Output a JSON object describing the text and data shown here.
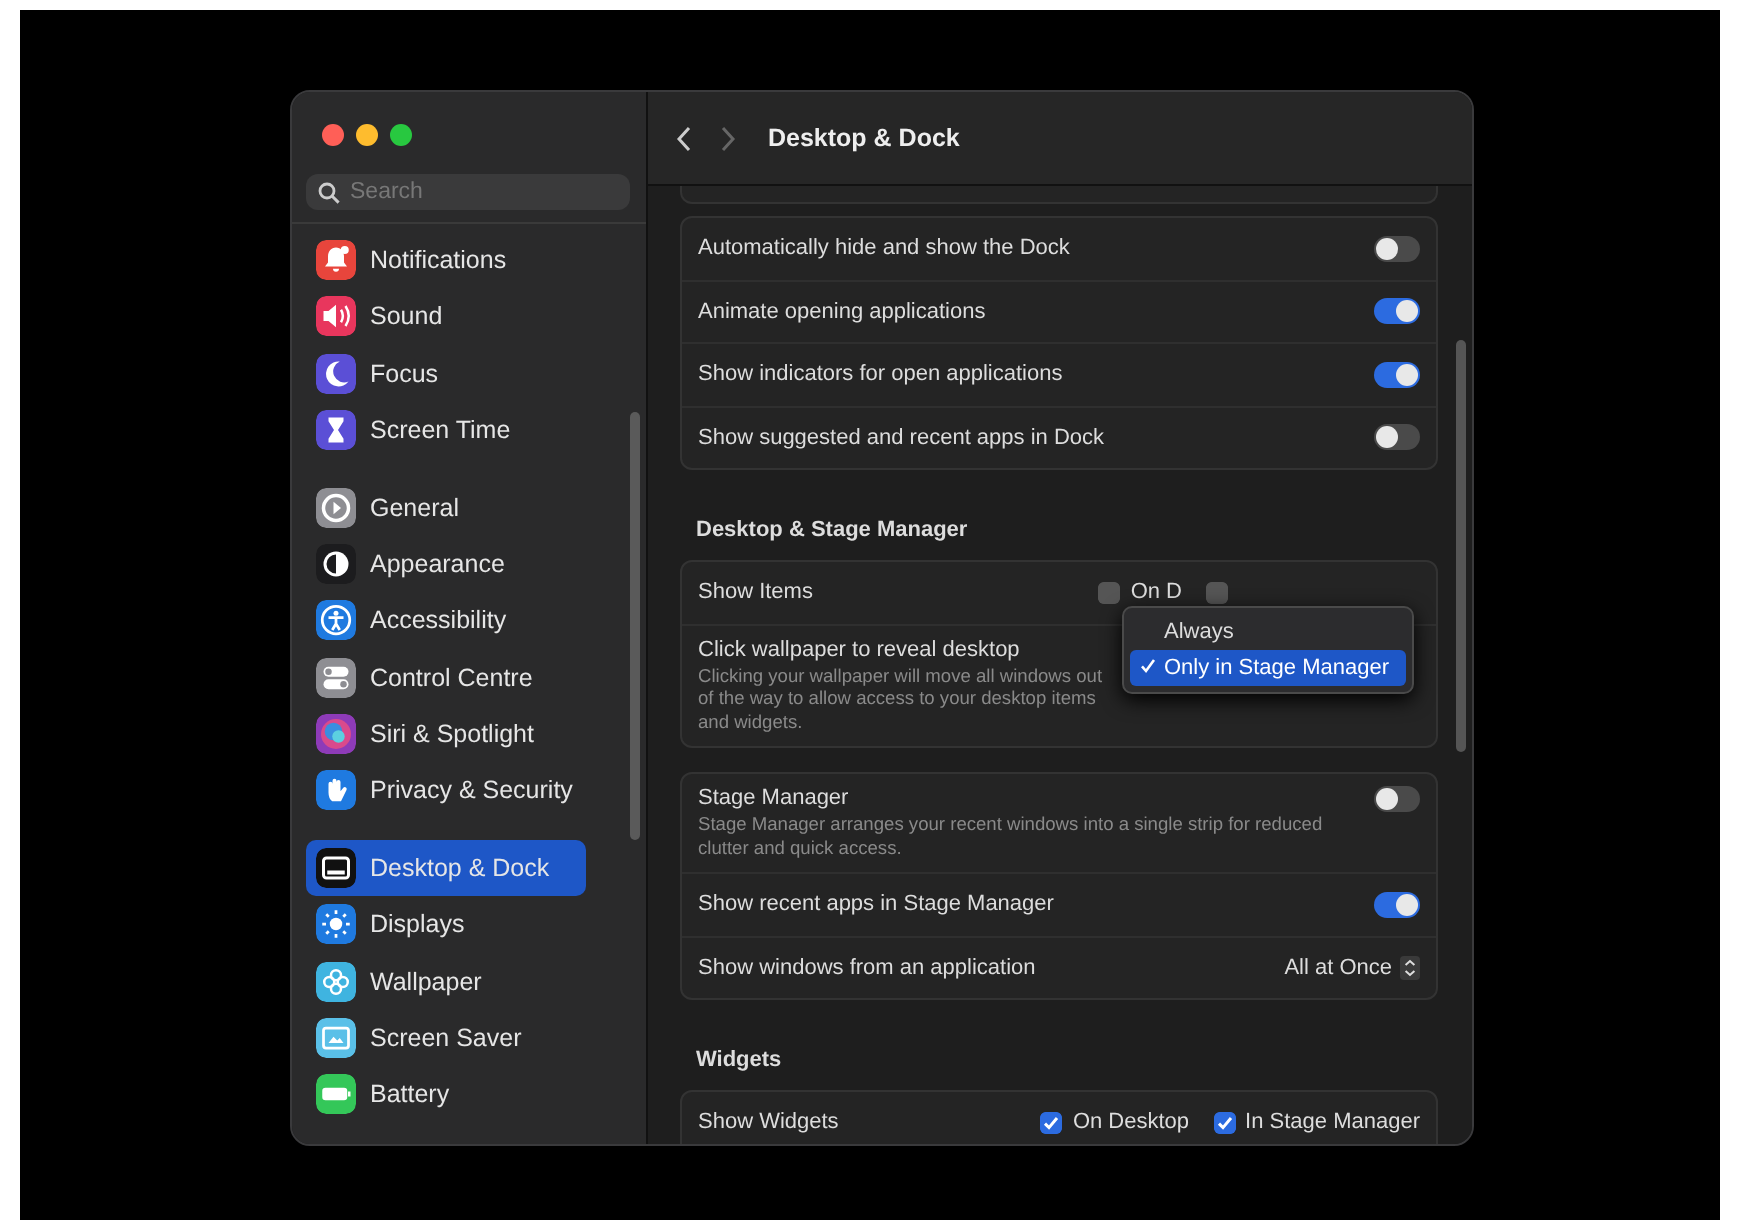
{
  "sidebar": {
    "search": {
      "placeholder": "Search"
    },
    "groups": [
      [
        {
          "label": "Notifications",
          "color": "#e8453c",
          "selected": false
        },
        {
          "label": "Sound",
          "color": "#e8365d",
          "selected": false
        },
        {
          "label": "Focus",
          "color": "#5b4fd6",
          "selected": false
        },
        {
          "label": "Screen Time",
          "color": "#5b4fd6",
          "selected": false
        }
      ],
      [
        {
          "label": "General",
          "color": "#8e8e93",
          "selected": false
        },
        {
          "label": "Appearance",
          "color": "#1c1c1e",
          "selected": false
        },
        {
          "label": "Accessibility",
          "color": "#1f7ae0",
          "selected": false
        },
        {
          "label": "Control Centre",
          "color": "#8e8e93",
          "selected": false
        },
        {
          "label": "Siri & Spotlight",
          "color": "#8e3bb8",
          "selected": false
        },
        {
          "label": "Privacy & Security",
          "color": "#1f7ae0",
          "selected": false
        }
      ],
      [
        {
          "label": "Desktop & Dock",
          "color": "#111111",
          "selected": true
        },
        {
          "label": "Displays",
          "color": "#1f7ae0",
          "selected": false
        },
        {
          "label": "Wallpaper",
          "color": "#3fb4e0",
          "selected": false
        },
        {
          "label": "Screen Saver",
          "color": "#5ac0e8",
          "selected": false
        },
        {
          "label": "Battery",
          "color": "#34c759",
          "selected": false
        }
      ]
    ]
  },
  "toolbar": {
    "title": "Desktop & Dock"
  },
  "sections": [
    {
      "rows": [
        {
          "kind": "toggle",
          "label": "Automatically hide and show the Dock",
          "on": false
        },
        {
          "kind": "toggle",
          "label": "Animate opening applications",
          "on": true
        },
        {
          "kind": "toggle",
          "label": "Show indicators for open applications",
          "on": true
        },
        {
          "kind": "toggle",
          "label": "Show suggested and recent apps in Dock",
          "on": false
        }
      ]
    },
    {
      "heading": "Desktop & Stage Manager",
      "menu": {
        "items": [
          {
            "label": "Always",
            "selected": false
          },
          {
            "label": "Only in Stage Manager",
            "selected": true
          }
        ]
      },
      "rows": [
        {
          "kind": "checks",
          "label": "Show Items",
          "options": [
            {
              "label": "On D",
              "checked": false
            },
            {
              "checked": false
            }
          ]
        },
        {
          "kind": "popup",
          "label": "Click wallpaper to reveal desktop",
          "description": "Clicking your wallpaper will move all windows out of the way to allow access to your desktop items and widgets."
        }
      ]
    },
    {
      "rows": [
        {
          "kind": "toggle",
          "label": "Stage Manager",
          "description": "Stage Manager arranges your recent windows into a single strip for reduced clutter and quick access.",
          "on": false
        },
        {
          "kind": "toggle",
          "label": "Show recent apps in Stage Manager",
          "on": true
        },
        {
          "kind": "select",
          "label": "Show windows from an application",
          "value": "All at Once"
        }
      ]
    },
    {
      "heading": "Widgets",
      "rows": [
        {
          "kind": "checks",
          "label": "Show Widgets",
          "options": [
            {
              "label": "On Desktop",
              "checked": true
            },
            {
              "label": "In Stage Manager",
              "checked": true
            }
          ]
        }
      ]
    }
  ]
}
